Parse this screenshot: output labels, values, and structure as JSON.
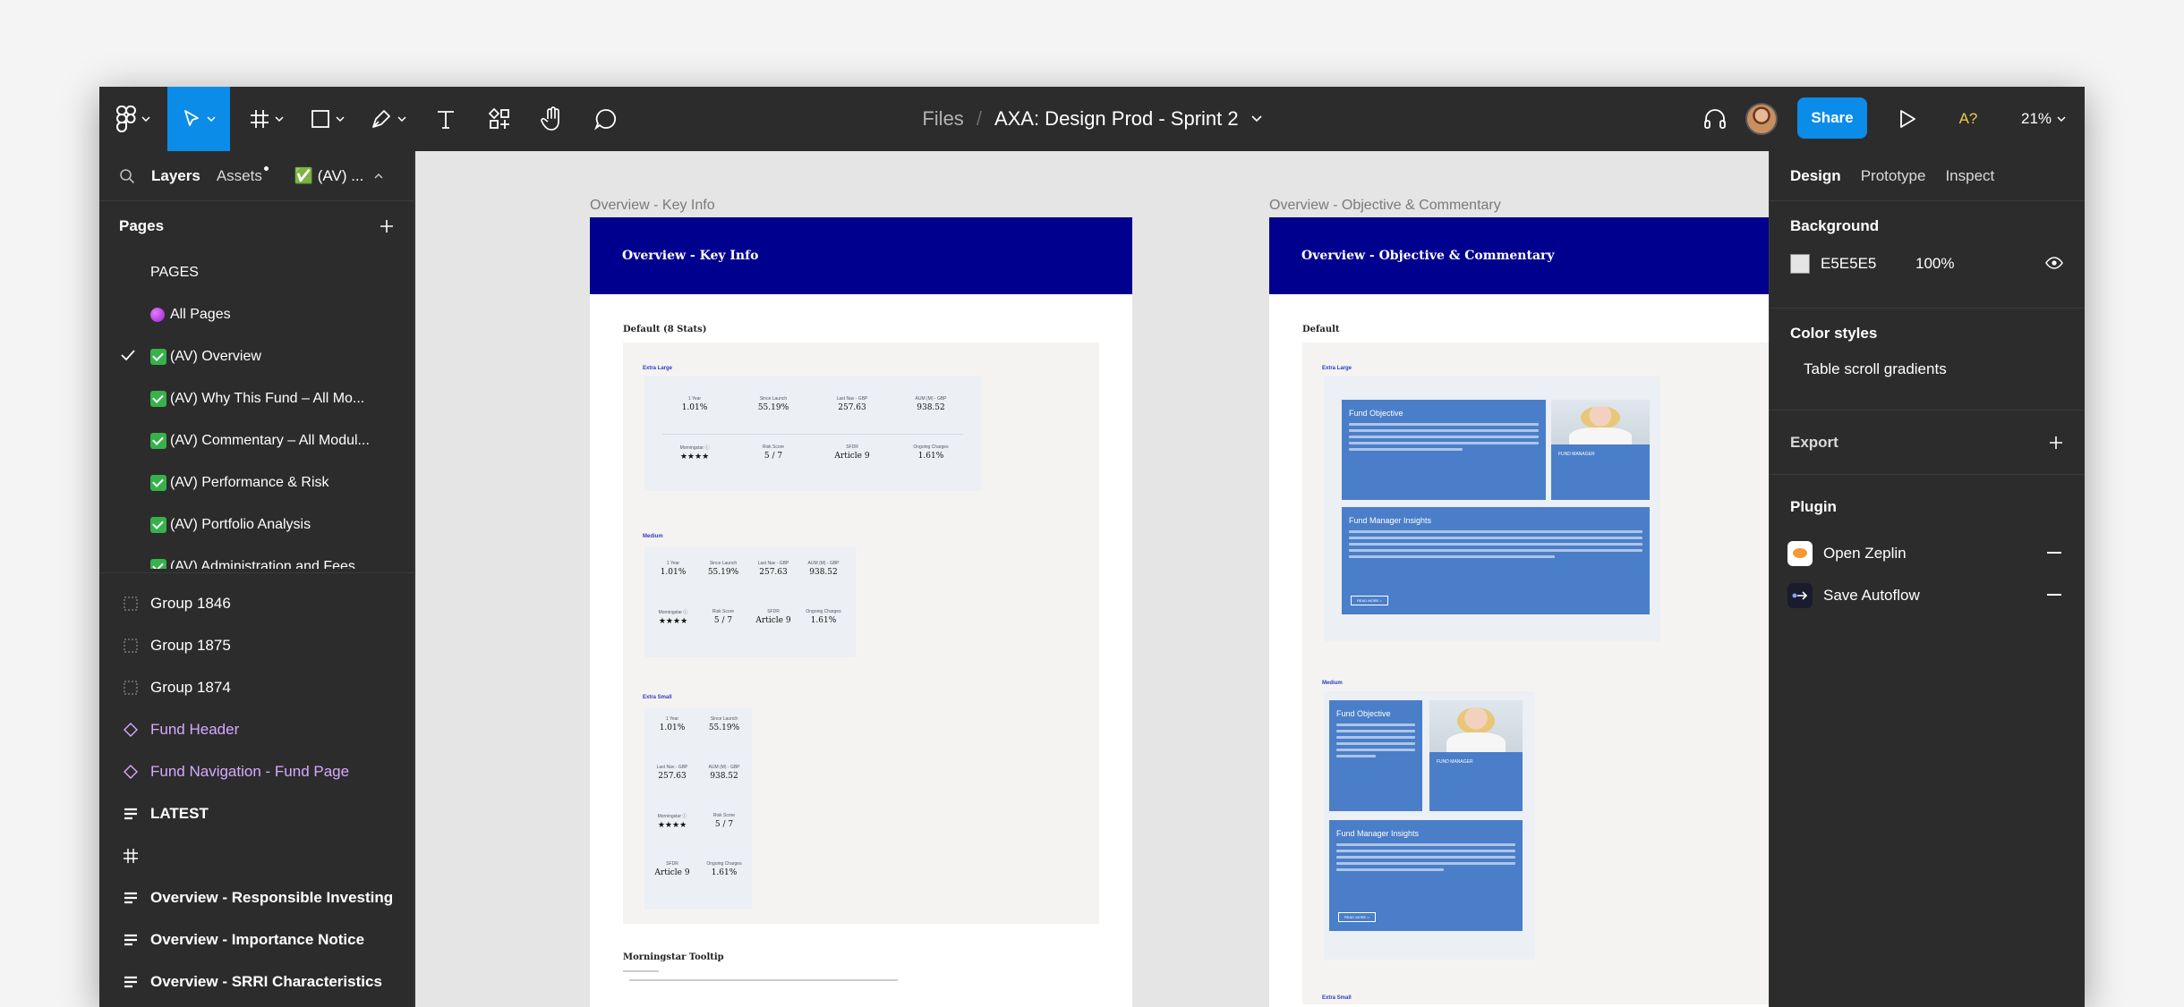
{
  "toolbar": {
    "breadcrumb_files": "Files",
    "breadcrumb_sep": "/",
    "file_name": "AXA: Design Prod - Sprint 2",
    "share_label": "Share",
    "accessibility_label": "A?",
    "zoom": "21%"
  },
  "left_panel": {
    "tabs": {
      "layers": "Layers",
      "assets": "Assets",
      "page": "✅ (AV) ..."
    },
    "pages_title": "Pages",
    "pages": [
      {
        "label": "PAGES"
      },
      {
        "label": "All Pages"
      },
      {
        "label": "(AV) Overview"
      },
      {
        "label": "(AV) Why This Fund –  All Mo..."
      },
      {
        "label": "(AV) Commentary – All Modul..."
      },
      {
        "label": "(AV) Performance & Risk"
      },
      {
        "label": "(AV) Portfolio Analysis"
      },
      {
        "label": "(AV) Administration and Fees"
      }
    ],
    "layers": [
      {
        "label": "Group 1846"
      },
      {
        "label": "Group 1875"
      },
      {
        "label": "Group 1874"
      },
      {
        "label": "Fund Header"
      },
      {
        "label": "Fund Navigation - Fund Page"
      },
      {
        "label": "LATEST"
      },
      {
        "label": ""
      },
      {
        "label": "Overview - Responsible Investing"
      },
      {
        "label": "Overview - Importance Notice"
      },
      {
        "label": "Overview - SRRI Characteristics"
      }
    ]
  },
  "canvas": {
    "frame1": {
      "label": "Overview - Key Info",
      "header": "Overview - Key Info",
      "section": "Default (8 Stats)",
      "sizes": {
        "large": "Extra Large",
        "medium": "Medium",
        "small": "Extra Small"
      },
      "stats": [
        {
          "title": "1 Year",
          "value": "1.01%"
        },
        {
          "title": "Since Launch",
          "value": "55.19%"
        },
        {
          "title": "Last Nav - GBP",
          "value": "257.63"
        },
        {
          "title": "AUM (M) - GBP",
          "value": "938.52"
        },
        {
          "title": "Morningstar ⓘ",
          "value": "★★★★"
        },
        {
          "title": "Risk Score",
          "value": "5 / 7"
        },
        {
          "title": "SFDR",
          "value": "Article 9"
        },
        {
          "title": "Ongoing Charges",
          "value": "1.61%"
        }
      ],
      "tooltip_title": "Morningstar Tooltip"
    },
    "frame2": {
      "label": "Overview - Objective & Commentary",
      "header": "Overview - Objective & Commentary",
      "section": "Default",
      "sizes": {
        "large": "Extra Large",
        "medium": "Medium",
        "small": "Extra Small"
      },
      "objective_title": "Fund Objective",
      "insights_title": "Fund Manager Insights",
      "read_more": "READ MORE  >",
      "manager_label": "FUND MANAGER"
    }
  },
  "right_panel": {
    "tabs": {
      "design": "Design",
      "prototype": "Prototype",
      "inspect": "Inspect"
    },
    "background_title": "Background",
    "background_hex": "E5E5E5",
    "background_opacity": "100%",
    "color_styles_title": "Color styles",
    "color_style_item": "Table scroll gradients",
    "export_title": "Export",
    "plugin_title": "Plugin",
    "plugins": [
      {
        "label": "Open Zeplin"
      },
      {
        "label": "Save Autoflow"
      }
    ]
  },
  "colors": {
    "accent": "#0c8ce9",
    "frame_header": "#00008f",
    "card_blue": "#4a7ec9",
    "canvas_bg": "#e5e5e5",
    "component": "#d7a9ff"
  }
}
